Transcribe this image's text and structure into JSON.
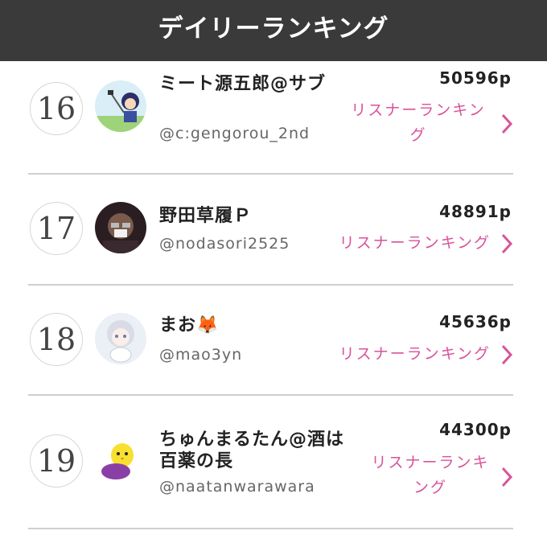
{
  "header": {
    "title": "デイリーランキング"
  },
  "rankings": [
    {
      "rank": "16",
      "name": "ミート源五郎@サブ",
      "handle": "@c:gengorou_2nd",
      "points": "50596p",
      "listener_label": "リスナーランキング"
    },
    {
      "rank": "17",
      "name": "野田草履Ｐ",
      "handle": "@nodasori2525",
      "points": "48891p",
      "listener_label": "リスナーランキング"
    },
    {
      "rank": "18",
      "name": "まお🦊",
      "handle": "@mao3yn",
      "points": "45636p",
      "listener_label": "リスナーランキング"
    },
    {
      "rank": "19",
      "name": "ちゅんまるたん@酒は百薬の長",
      "handle": "@naatanwarawara",
      "points": "44300p",
      "listener_label": "リスナーランキング"
    }
  ],
  "colors": {
    "header_bg": "#3a3a3a",
    "accent": "#d9539a"
  },
  "icons": [
    "chevron-right-icon",
    "avatar"
  ]
}
